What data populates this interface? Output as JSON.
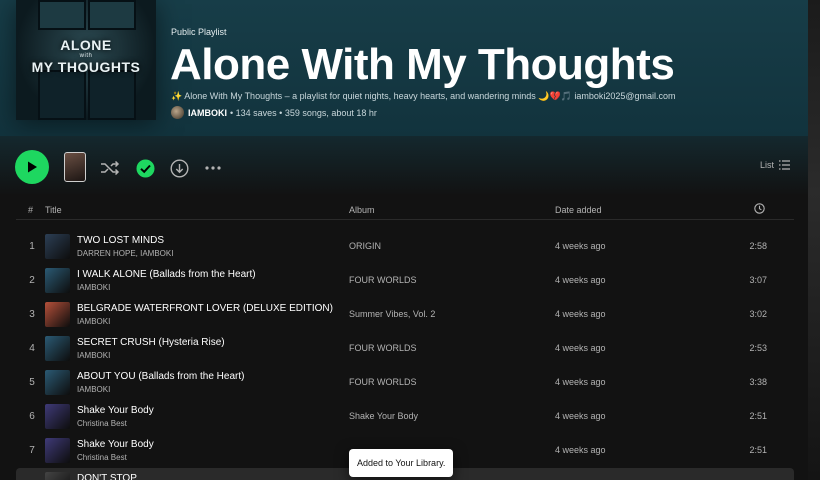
{
  "playlist": {
    "type_label": "Public Playlist",
    "title": "Alone With My Thoughts",
    "description": "✨ Alone With My Thoughts – a playlist for quiet nights, heavy hearts, and wandering minds 🌙💔🎵 iamboki2025@gmail.com",
    "owner": "IAMBOKI",
    "stats": "• 134 saves • 359 songs, about 18 hr",
    "cover_text_line1": "ALONE",
    "cover_text_line2": "with",
    "cover_text_line3": "MY THOUGHTS"
  },
  "controls": {
    "view_label": "List",
    "play_icon": "play-icon",
    "shuffle_icon": "shuffle-icon",
    "saved_icon": "check-circle-icon",
    "download_icon": "download-icon",
    "more_icon": "more-icon",
    "accent": "#1ed760"
  },
  "table": {
    "col_num": "#",
    "col_title": "Title",
    "col_album": "Album",
    "col_date": "Date added",
    "col_duration_icon": "clock-icon",
    "rows": [
      {
        "num": "1",
        "title": "TWO LOST MINDS",
        "artist": "DARREN HOPE, IAMBOKI",
        "album": "ORIGIN",
        "date": "4 weeks ago",
        "duration": "2:58",
        "thumb": "#2c3f55"
      },
      {
        "num": "2",
        "title": "I WALK ALONE (Ballads from the Heart)",
        "artist": "IAMBOKI",
        "album": "FOUR WORLDS",
        "date": "4 weeks ago",
        "duration": "3:07",
        "thumb": "#2b5a74"
      },
      {
        "num": "3",
        "title": "BELGRADE WATERFRONT LOVER (DELUXE EDITION)",
        "artist": "IAMBOKI",
        "album": "Summer Vibes, Vol. 2",
        "date": "4 weeks ago",
        "duration": "3:02",
        "thumb": "#b5503a"
      },
      {
        "num": "4",
        "title": "SECRET CRUSH (Hysteria Rise)",
        "artist": "IAMBOKI",
        "album": "FOUR WORLDS",
        "date": "4 weeks ago",
        "duration": "2:53",
        "thumb": "#2b5a74"
      },
      {
        "num": "5",
        "title": "ABOUT YOU (Ballads from the Heart)",
        "artist": "IAMBOKI",
        "album": "FOUR WORLDS",
        "date": "4 weeks ago",
        "duration": "3:38",
        "thumb": "#2b5a74"
      },
      {
        "num": "6",
        "title": "Shake Your Body",
        "artist": "Christina Best",
        "album": "Shake Your Body",
        "date": "4 weeks ago",
        "duration": "2:51",
        "thumb": "#3f3a78"
      },
      {
        "num": "7",
        "title": "Shake Your Body",
        "artist": "Christina Best",
        "album": "",
        "date": "4 weeks ago",
        "duration": "2:51",
        "thumb": "#3f3a78"
      },
      {
        "num": "",
        "title": "DON'T STOP",
        "artist": "",
        "album": "",
        "date": "",
        "duration": "",
        "thumb": "#444444"
      }
    ]
  },
  "toast": {
    "message": "Added to Your Library."
  }
}
